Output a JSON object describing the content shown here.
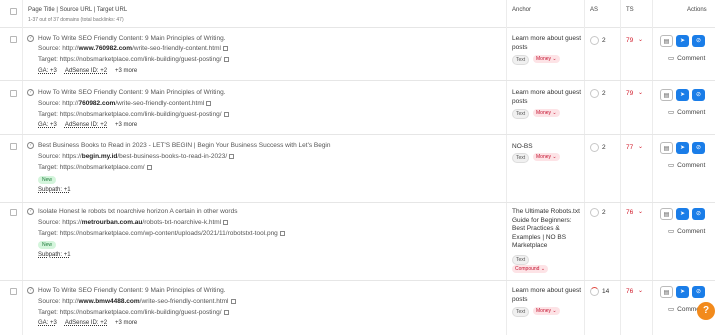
{
  "header": {
    "col_page": "Page Title | Source URL | Target URL",
    "summary": "1-37 out of 37 domains (total backlinks: 47)",
    "col_anchor": "Anchor",
    "col_as": "AS",
    "col_ts": "TS",
    "col_actions": "Actions"
  },
  "rows": [
    {
      "title": "How To Write SEO Friendly Content: 9 Main Principles of Writing.",
      "source_prefix": "Source: http://",
      "source_domain": "www.760982.com",
      "source_path": "/write-seo-friendly-content.html",
      "target": "Target: https://nobsmarketplace.com/link-building/guest-posting/",
      "ga": "GA: +3",
      "adsense": "AdSense ID: +2",
      "more": "+3 more",
      "anchor": "Learn more about guest posts",
      "tag1": "Text",
      "tag2": "Money",
      "as": "2",
      "ts": "79",
      "comment": "Comment"
    },
    {
      "title": "How To Write SEO Friendly Content: 9 Main Principles of Writing.",
      "source_prefix": "Source: http://",
      "source_domain": "760982.com",
      "source_path": "/write-seo-friendly-content.html",
      "target": "Target: https://nobsmarketplace.com/link-building/guest-posting/",
      "ga": "GA: +3",
      "adsense": "AdSense ID: +2",
      "more": "+3 more",
      "anchor": "Learn more about guest posts",
      "tag1": "Text",
      "tag2": "Money",
      "as": "2",
      "ts": "79",
      "comment": "Comment"
    },
    {
      "title": "Best Business Books to Read in 2023 - LET'S BEGIN | Begin Your Business Success with Let's Begin",
      "source_prefix": "Source: https://",
      "source_domain": "begin.my.id",
      "source_path": "/best-business-books-to-read-in-2023/",
      "target": "Target: https://nobsmarketplace.com/",
      "badge": "New",
      "subpath": "Subpath: +1",
      "anchor": "NO-BS",
      "tag1": "Text",
      "tag2": "Money",
      "as": "2",
      "ts": "77",
      "comment": "Comment"
    },
    {
      "title": "Isolate Honest le robots txt noarchive horizon A certain in other words",
      "source_prefix": "Source: https://",
      "source_domain": "metrourban.com.au",
      "source_path": "/robots-txt-noarchive-k.html",
      "target": "Target: https://nobsmarketplace.com/wp-content/uploads/2021/11/robotstxt-tool.png",
      "badge": "New",
      "subpath": "Subpath: +1",
      "anchor": "The Ultimate Robots.txt Guide for Beginners: Best Practices & Examples | NO BS Marketplace",
      "tag1": "Text",
      "tag2": "Compound",
      "as": "2",
      "ts": "76",
      "comment": "Comment"
    },
    {
      "title": "How To Write SEO Friendly Content: 9 Main Principles of Writing.",
      "source_prefix": "Source: http://",
      "source_domain": "www.bmw4488.com",
      "source_path": "/write-seo-friendly-content.html",
      "target": "Target: https://nobsmarketplace.com/link-building/guest-posting/",
      "ga": "GA: +3",
      "adsense": "AdSense ID: +2",
      "more": "+3 more",
      "anchor": "Learn more about guest posts",
      "tag1": "Text",
      "tag2": "Money",
      "as": "14",
      "ts": "76",
      "comment": "Comment"
    }
  ],
  "help": "?",
  "colors": {
    "accent": "#1a7de8",
    "score_red": "#d11a2a",
    "help_orange": "#f28a1c",
    "badge_green": "#d4f5dc"
  }
}
